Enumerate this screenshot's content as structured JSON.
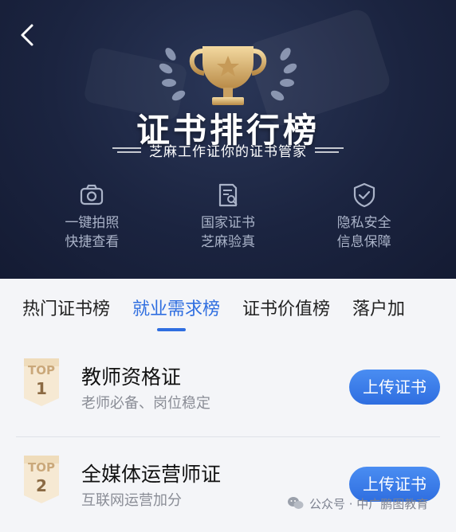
{
  "header": {
    "title": "证书排行榜",
    "subtitle": "芝麻工作证你的证书管家",
    "colors": {
      "hero_bg": "#1b2440",
      "gold": "#d9b271"
    }
  },
  "features": [
    {
      "icon": "camera-icon",
      "line1": "一键拍照",
      "line2": "快捷查看"
    },
    {
      "icon": "certificate-search-icon",
      "line1": "国家证书",
      "line2": "芝麻验真"
    },
    {
      "icon": "shield-check-icon",
      "line1": "隐私安全",
      "line2": "信息保障"
    }
  ],
  "tabs": [
    {
      "label": "热门证书榜",
      "active": false
    },
    {
      "label": "就业需求榜",
      "active": true
    },
    {
      "label": "证书价值榜",
      "active": false
    },
    {
      "label": "落户加",
      "active": false
    }
  ],
  "ranking": [
    {
      "badge_top": "TOP",
      "rank": "1",
      "title": "教师资格证",
      "subtitle": "老师必备、岗位稳定",
      "button": "上传证书"
    },
    {
      "badge_top": "TOP",
      "rank": "2",
      "title": "全媒体运营师证",
      "subtitle": "互联网运营加分",
      "button": "上传证书"
    }
  ],
  "watermark": {
    "text": "公众号 · 中广鹏图教育",
    "icon": "wechat-icon"
  },
  "accent_color": "#2f6ee0"
}
